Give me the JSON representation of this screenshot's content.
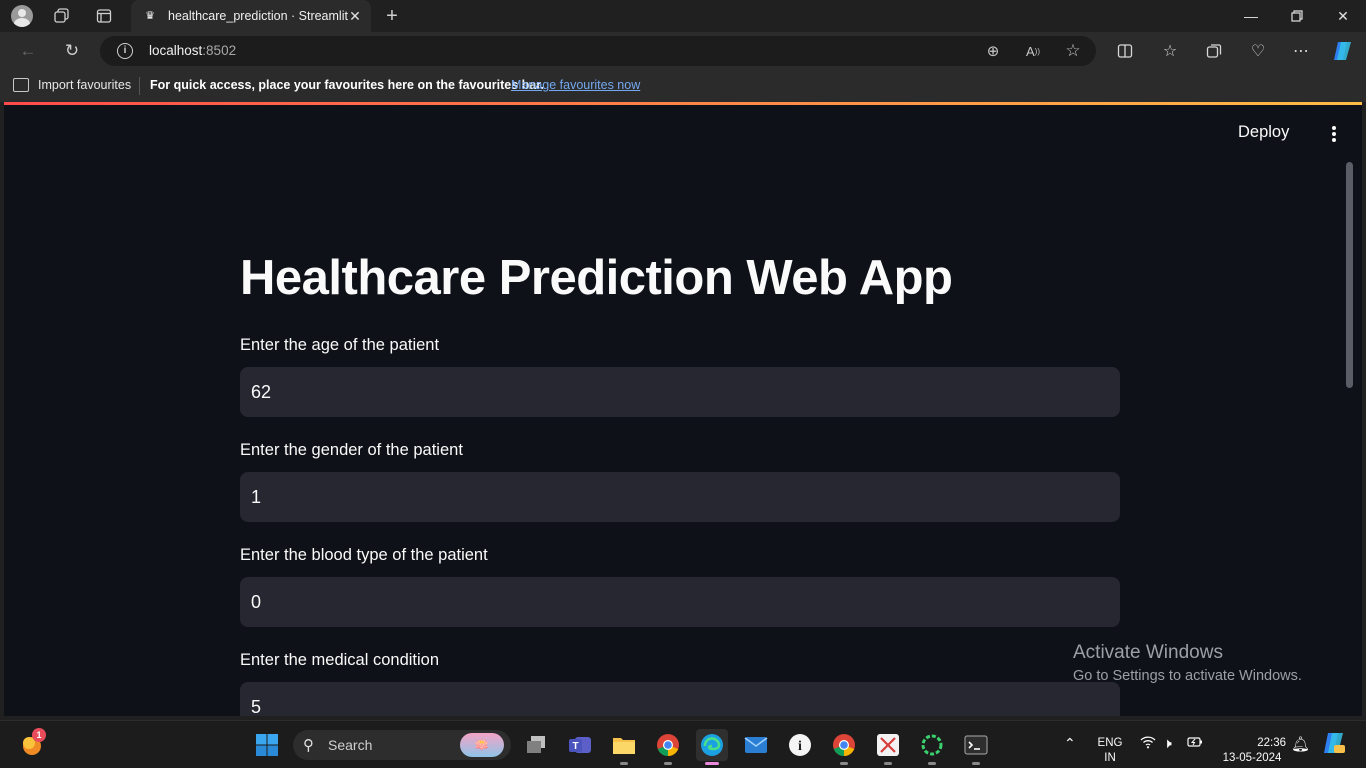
{
  "browser": {
    "tab_title": "healthcare_prediction · Streamlit",
    "url_host": "localhost",
    "url_port": ":8502",
    "favourites_bar": {
      "import_label": "Import favourites",
      "message": "For quick access, place your favourites here on the favourites bar.",
      "link": "Manage favourites now"
    }
  },
  "app": {
    "deploy_label": "Deploy",
    "title": "Healthcare Prediction Web App",
    "fields": [
      {
        "label": "Enter the age of the patient",
        "value": "62"
      },
      {
        "label": "Enter the gender of the patient",
        "value": "1"
      },
      {
        "label": "Enter the blood type of the patient",
        "value": "0"
      },
      {
        "label": "Enter the medical condition",
        "value": "5"
      }
    ]
  },
  "watermark": {
    "line1": "Activate Windows",
    "line2": "Go to Settings to activate Windows."
  },
  "taskbar": {
    "search_label": "Search",
    "notification_count": "1",
    "language": "ENG",
    "region": "IN",
    "time": "22:36",
    "date": "13-05-2024"
  },
  "colors": {
    "page_bg": "#0e1117",
    "input_bg": "#262730",
    "accent_gradient_start": "#ff4b4b",
    "accent_gradient_end": "#ffbd45",
    "link": "#74a8f0"
  }
}
